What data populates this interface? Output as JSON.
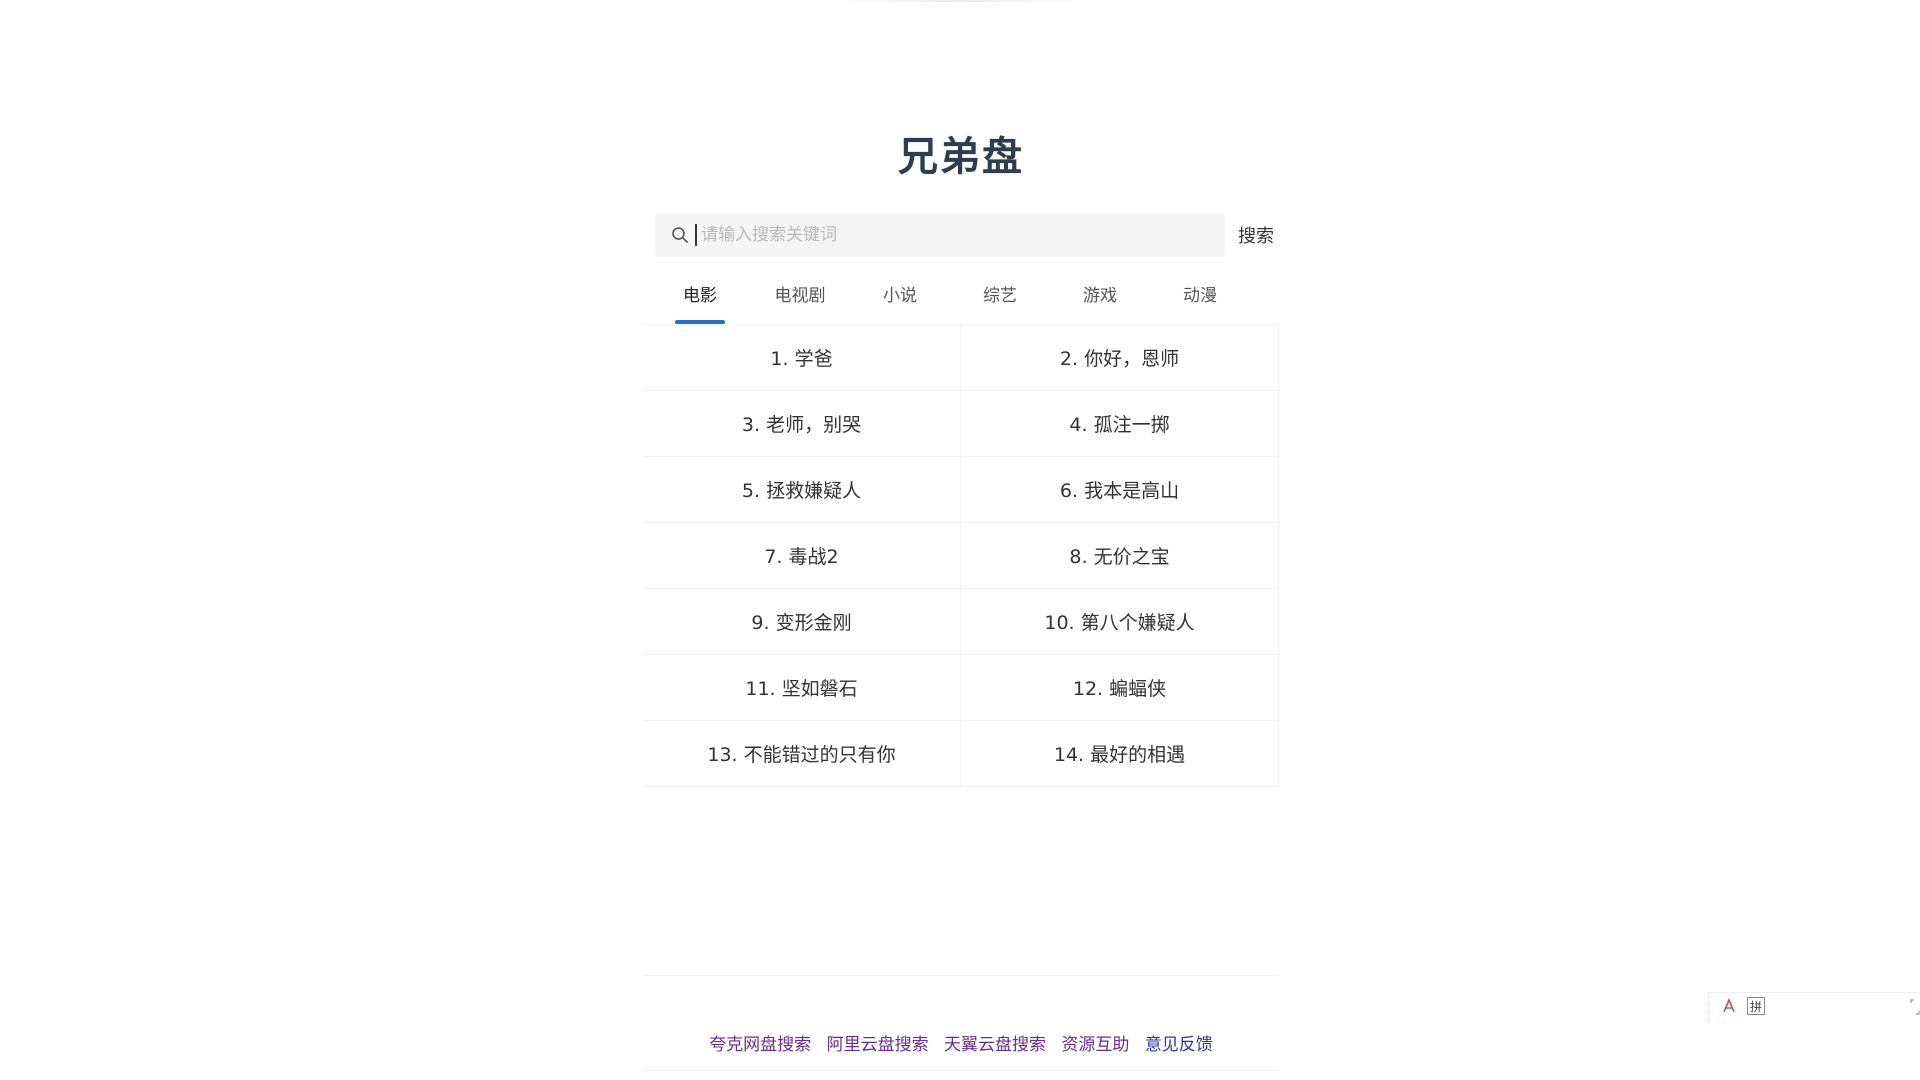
{
  "site": {
    "title": "兄弟盘"
  },
  "search": {
    "placeholder": "请输入搜索关键词",
    "value": "",
    "button_label": "搜索"
  },
  "tabs": [
    {
      "label": "电影",
      "active": true
    },
    {
      "label": "电视剧",
      "active": false
    },
    {
      "label": "小说",
      "active": false
    },
    {
      "label": "综艺",
      "active": false
    },
    {
      "label": "游戏",
      "active": false
    },
    {
      "label": "动漫",
      "active": false
    }
  ],
  "rankings": [
    [
      "1. 学爸",
      "2. 你好，恩师"
    ],
    [
      "3. 老师，别哭",
      "4. 孤注一掷"
    ],
    [
      "5. 拯救嫌疑人",
      "6. 我本是高山"
    ],
    [
      "7. 毒战2",
      "8. 无价之宝"
    ],
    [
      "9. 变形金刚",
      "10. 第八个嫌疑人"
    ],
    [
      "11. 坚如磐石",
      "12. 蝙蝠侠"
    ],
    [
      "13. 不能错过的只有你",
      "14. 最好的相遇"
    ]
  ],
  "footer": {
    "links": [
      {
        "label": "夸克网盘搜索"
      },
      {
        "label": "阿里云盘搜索"
      },
      {
        "label": "天翼云盘搜索"
      },
      {
        "label": "资源互助"
      },
      {
        "label": "意见反馈"
      }
    ]
  },
  "ime": {
    "pin_label": "拼",
    "expand_icon": "expand-icon"
  },
  "colors": {
    "title": "#2c3e50",
    "tab_active_underline": "#2f6fc0",
    "footer_link": "#6a2c8e",
    "footer_link_feedback": "#2b3a9a"
  }
}
